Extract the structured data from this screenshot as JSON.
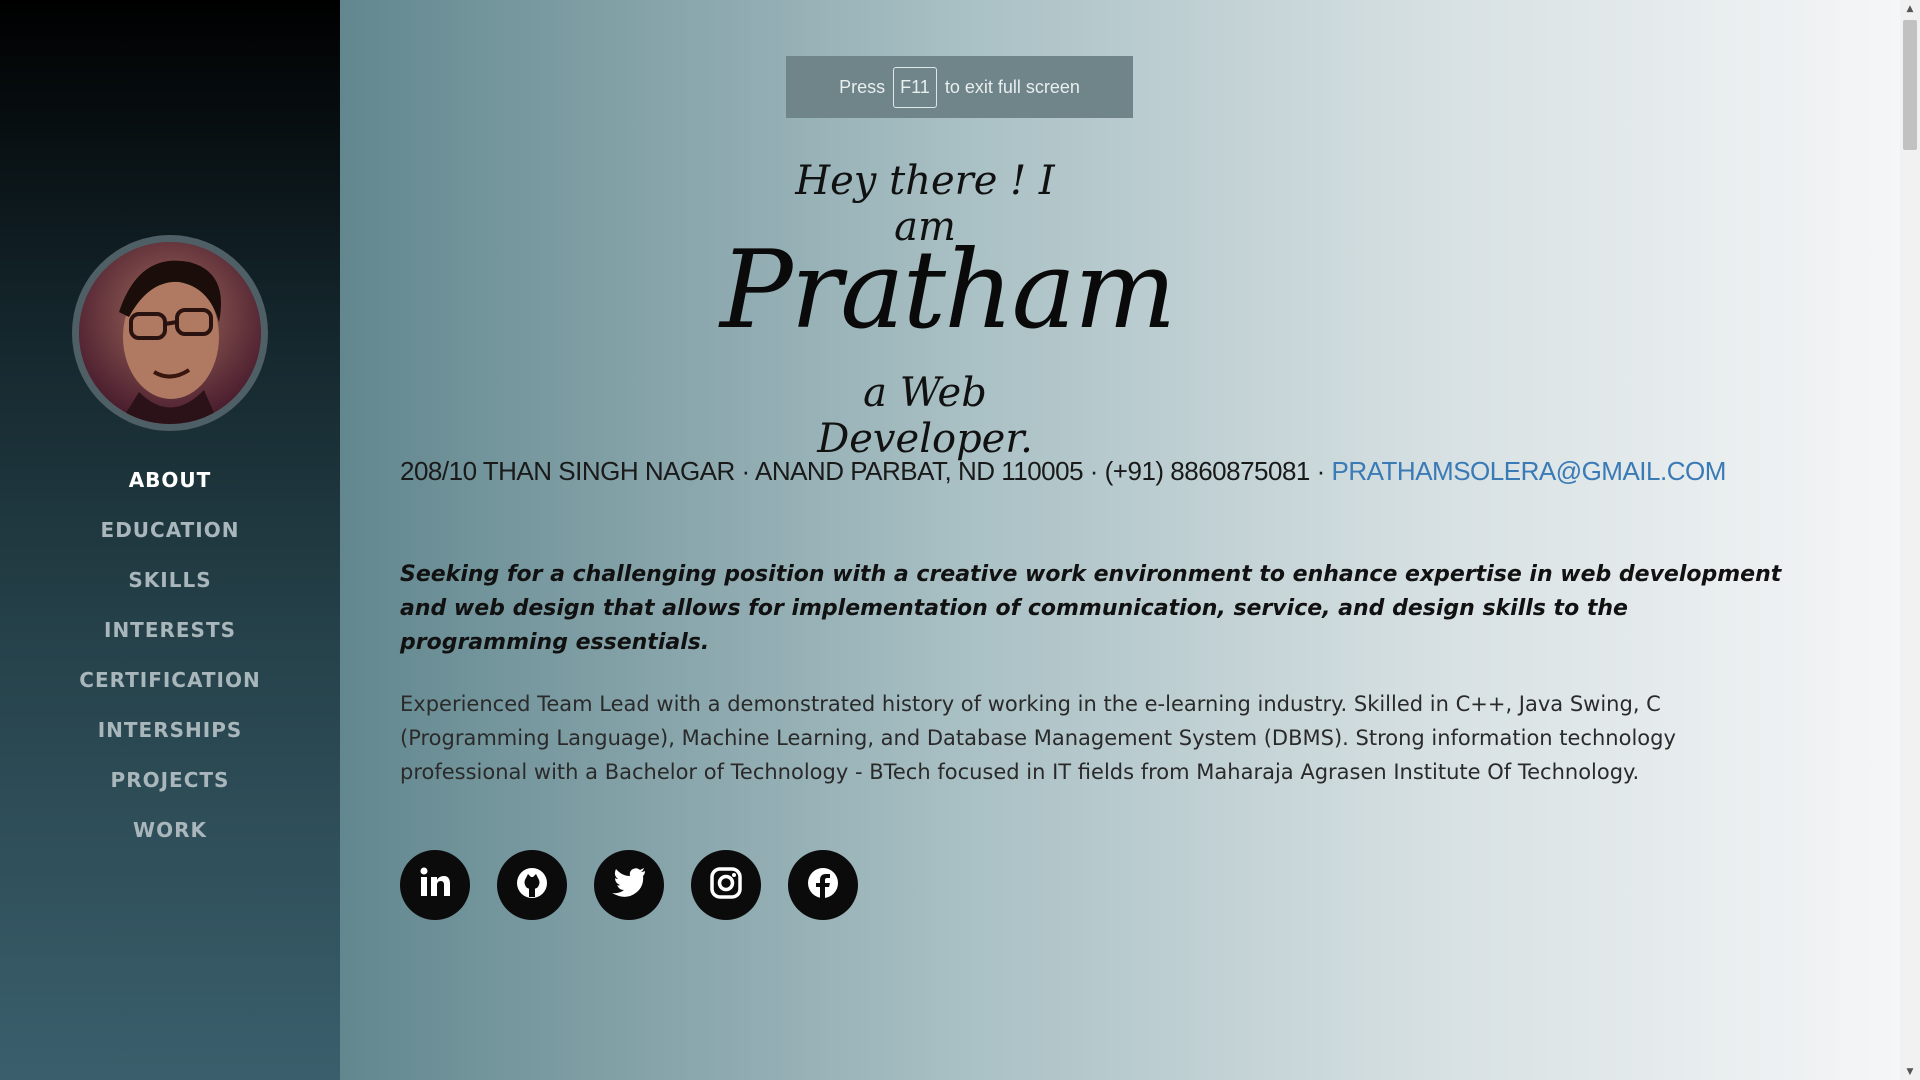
{
  "sidebar": {
    "nav_items": [
      {
        "label": "ABOUT"
      },
      {
        "label": "EDUCATION"
      },
      {
        "label": "SKILLS"
      },
      {
        "label": "INTERESTS"
      },
      {
        "label": "CERTIFICATION"
      },
      {
        "label": "INTERSHIPS"
      },
      {
        "label": "PROJECTS"
      },
      {
        "label": "WORK"
      }
    ],
    "active_item": "ABOUT"
  },
  "fullscreen_notice": {
    "prefix": "Press",
    "key": "F11",
    "suffix": "to exit full screen"
  },
  "hero": {
    "greeting": "Hey there ! I am",
    "name": "Pratham",
    "role": "a Web Developer."
  },
  "contact": {
    "address": "208/10 THAN SINGH NAGAR · ANAND PARBAT, ND 110005 · (+91) 8860875081 ·",
    "email": "PRATHAMSOLERA@GMAIL.COM"
  },
  "objective": "Seeking for a challenging position with a creative work environment to enhance expertise in web development and web design that allows for implementation of communication, service, and design skills to the programming essentials.",
  "summary": "Experienced Team Lead with a demonstrated history of working in the e-learning industry. Skilled in C++, Java Swing, C (Programming Language), Machine Learning, and Database Management System (DBMS). Strong information technology professional with a Bachelor of Technology - BTech focused in IT fields from Maharaja Agrasen Institute Of Technology.",
  "socials": [
    {
      "icon": "linkedin-icon"
    },
    {
      "icon": "github-icon"
    },
    {
      "icon": "twitter-icon"
    },
    {
      "icon": "instagram-icon"
    },
    {
      "icon": "facebook-icon"
    }
  ],
  "colors": {
    "email_link": "#3a7ab5",
    "nav_active": "#ffffff",
    "nav_inactive": "#a9b6bb",
    "social_bg": "#0b0b0b"
  }
}
